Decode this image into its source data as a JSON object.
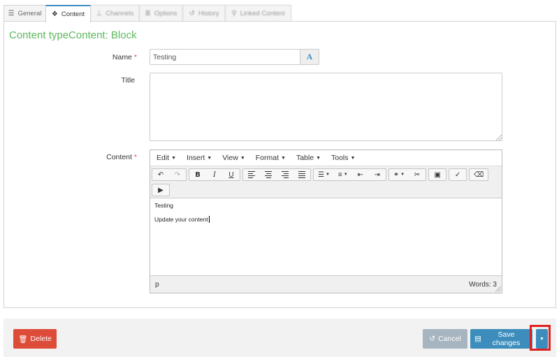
{
  "tabs": [
    {
      "label": "General",
      "icon": "sliders-icon"
    },
    {
      "label": "Content",
      "icon": "cubes-icon"
    },
    {
      "label": "Channels",
      "icon": "sitemap-icon"
    },
    {
      "label": "Options",
      "icon": "options-icon"
    },
    {
      "label": "History",
      "icon": "history-icon"
    },
    {
      "label": "Linked Content",
      "icon": "link-icon"
    }
  ],
  "page_title": "Content typeContent: Block",
  "form": {
    "name_label": "Name",
    "name_value": "Testing",
    "required_mark": "*",
    "translate_glyph": "A",
    "title_label": "Title",
    "title_value": "",
    "content_label": "Content"
  },
  "editor": {
    "menus": [
      "Edit",
      "Insert",
      "View",
      "Format",
      "Table",
      "Tools"
    ],
    "body_lines": [
      "Testing",
      "Update your content"
    ],
    "status_path": "p",
    "word_count": "Words: 3"
  },
  "footer": {
    "delete_label": "Delete",
    "cancel_label": "Cancel",
    "save_label": "Save changes"
  },
  "colors": {
    "accent": "#3c8dbc",
    "title_green": "#5cb85c",
    "danger": "#dd4b39",
    "cancel": "#a7b5c0",
    "highlight": "#e02020"
  }
}
